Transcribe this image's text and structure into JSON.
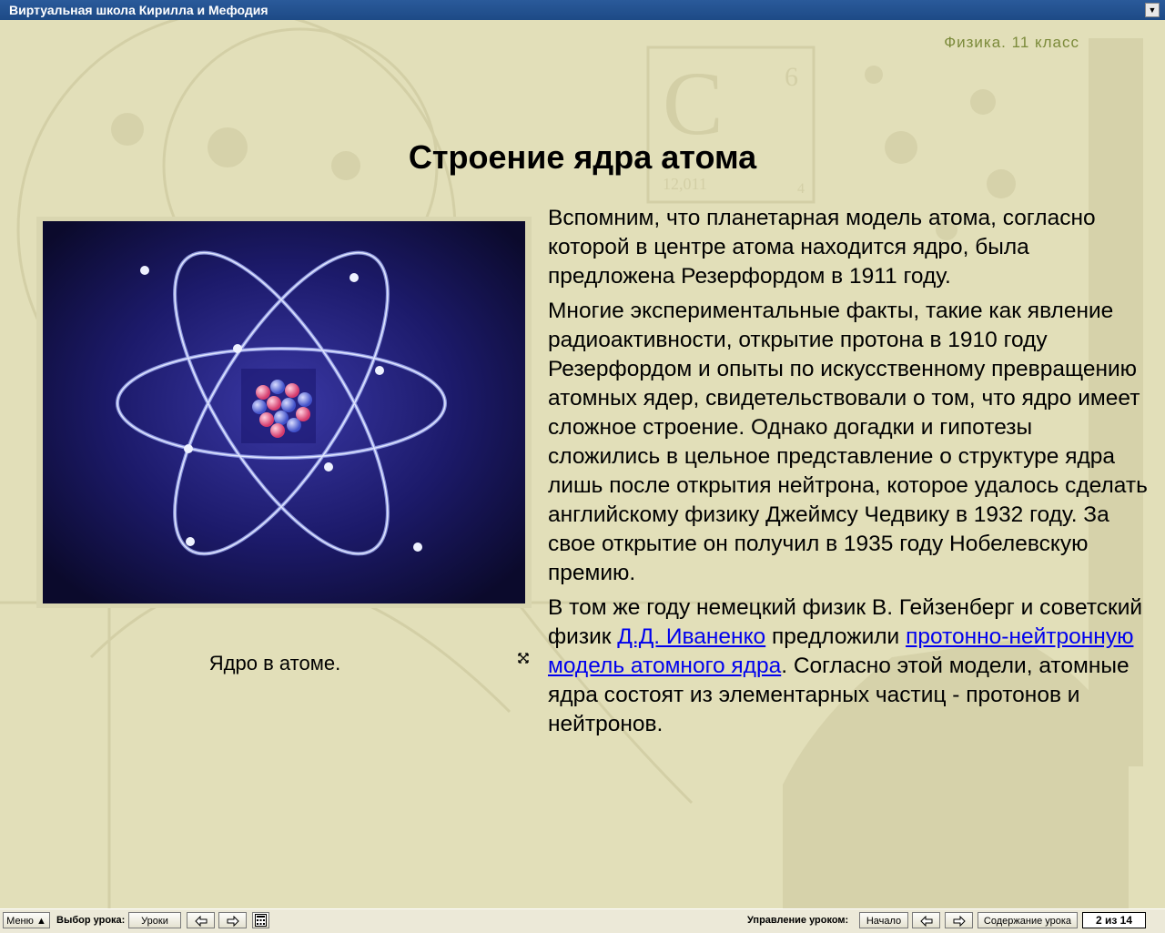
{
  "window": {
    "title": "Виртуальная школа Кирилла и Мефодия"
  },
  "header": {
    "subject": "Физика. 11 класс"
  },
  "page": {
    "title": "Строение ядра атома"
  },
  "figure": {
    "caption": "Ядро в атоме."
  },
  "body": {
    "p1": "Вспомним, что планетарная модель атома, согласно которой в центре атома находится ядро, была предложена Резерфордом в 1911 году.",
    "p2": "Многие экспериментальные факты, такие как явление радиоактивности, открытие протона в 1910 году Резерфордом и опыты по искусственному превращению атомных ядер, свидетельствовали о том, что ядро имеет сложное строение. Однако догадки и гипотезы сложились в цельное представление о структуре ядра лишь после открытия нейтрона, которое удалось сделать английскому физику Джеймсу Чедвику в 1932 году. За свое открытие он получил в 1935 году Нобелевскую премию.",
    "p3_a": "В том же году немецкий физик В. Гейзенберг и советский физик ",
    "p3_link1": "Д.Д. Иваненко",
    "p3_b": " предложили ",
    "p3_link2": "протонно-нейтронную модель атомного ядра",
    "p3_c": ". Согласно этой модели, атомные ядра состоят из элементарных частиц - протонов и нейтронов."
  },
  "background": {
    "element_symbol": "C",
    "atomic_number": "6",
    "atomic_mass": "12,011",
    "small_number": "4"
  },
  "toolbar": {
    "menu": "Меню ▲",
    "lesson_select_label": "Выбор урока:",
    "lessons": "Уроки",
    "lesson_control_label": "Управление уроком:",
    "start": "Начало",
    "contents": "Содержание урока",
    "page_counter": "2 из 14"
  },
  "colors": {
    "background": "#e2dfb9",
    "titlebar": "#1d4a86",
    "link": "#0000ee",
    "subject": "#7b8a3a"
  }
}
